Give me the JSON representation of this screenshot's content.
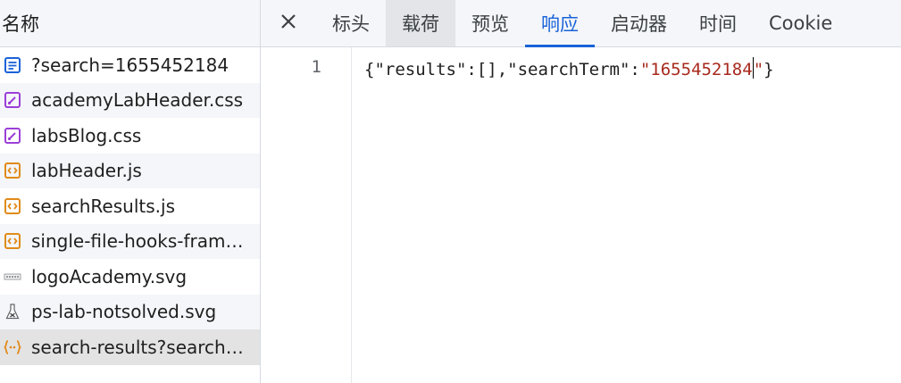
{
  "left_panel": {
    "header": "名称",
    "rows": [
      {
        "name": "?search=1655452184",
        "icon": "document-icon"
      },
      {
        "name": "academyLabHeader.css",
        "icon": "css-file-icon"
      },
      {
        "name": "labsBlog.css",
        "icon": "css-file-icon"
      },
      {
        "name": "labHeader.js",
        "icon": "script-file-icon"
      },
      {
        "name": "searchResults.js",
        "icon": "script-file-icon"
      },
      {
        "name": "single-file-hooks-fram…",
        "icon": "script-file-icon"
      },
      {
        "name": "logoAcademy.svg",
        "icon": "image-icon"
      },
      {
        "name": "ps-lab-notsolved.svg",
        "icon": "flask-image-icon"
      },
      {
        "name": "search-results?search=…",
        "icon": "json-icon"
      }
    ]
  },
  "tabs": {
    "close_icon": "close-icon",
    "items": [
      "标头",
      "载荷",
      "预览",
      "响应",
      "启动器",
      "时间",
      "Cookie"
    ],
    "active": "响应"
  },
  "response": {
    "line_number": "1",
    "code_prefix": "{\"results\":[],\"searchTerm\":",
    "code_string": "\"1655452184",
    "code_string_end": "\"",
    "code_suffix": "}"
  },
  "colors": {
    "accent": "#1a62d8",
    "string": "#a8291d",
    "doc_icon": "#1a62d8",
    "css_icon": "#9c3fd8",
    "js_icon": "#e08a19"
  }
}
